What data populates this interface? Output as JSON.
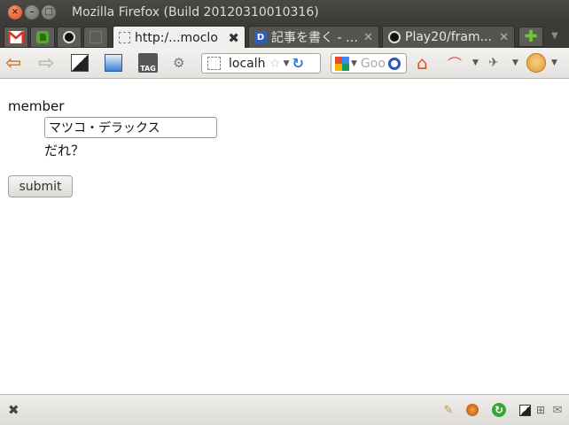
{
  "window": {
    "title": "Mozilla Firefox (Build 20120310010316)"
  },
  "tabs": [
    {
      "label": "http:/...moclo",
      "favicon": "blank-page-icon",
      "active": true
    },
    {
      "label": "記事を書く - t...",
      "favicon": "d-icon",
      "active": false
    },
    {
      "label": "Play20/fram...",
      "favicon": "github-icon",
      "active": false
    }
  ],
  "app_tabs": [
    "gmail-icon",
    "evernote-icon",
    "github-icon",
    "blank-app-icon"
  ],
  "toolbar": {
    "url_text": "localh",
    "search_placeholder": "Goo",
    "tag_label": "TAG"
  },
  "form": {
    "member_label": "member",
    "name_value": "マツコ・デラックス",
    "help_text": "だれ？",
    "submit_label": "submit"
  },
  "colors": {
    "accent_back": "#e07a1f",
    "title_bg": "#3c3b37",
    "content_bg": "#ffffff"
  }
}
